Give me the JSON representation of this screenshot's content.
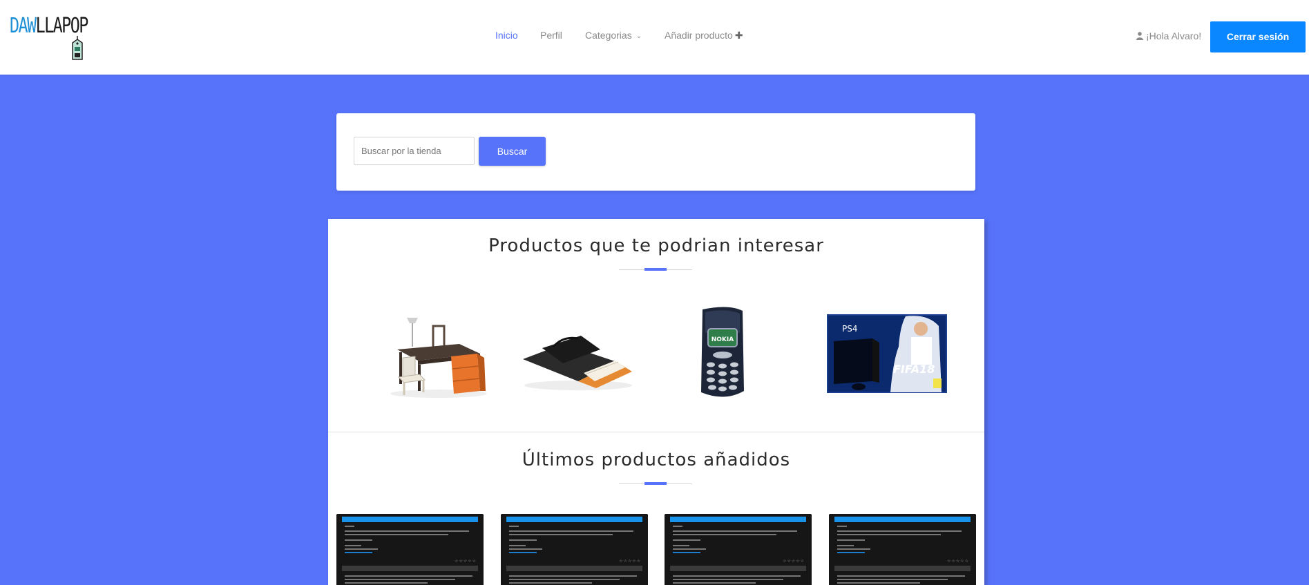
{
  "header": {
    "logo": {
      "part1": "DAW",
      "part2": "LLAPOP",
      "accent": "#1f8fd6"
    },
    "nav": {
      "inicio": "Inicio",
      "perfil": "Perfil",
      "categorias": "Categorias",
      "anadir": "Añadir producto"
    },
    "greeting": "¡Hola Alvaro!",
    "logout_label": "Cerrar sesión",
    "logout_color": "#0a86ff"
  },
  "search": {
    "placeholder": "Buscar por la tienda",
    "button_label": "Buscar"
  },
  "sections": {
    "recommended_title": "Productos que te podrian interesar",
    "latest_title": "Últimos productos añadidos"
  },
  "recommended_products": [
    {
      "icon": "desk-image"
    },
    {
      "icon": "bag-image"
    },
    {
      "icon": "nokia-phone-image",
      "brand_text": "NOKIA"
    },
    {
      "icon": "ps4-box-image",
      "brand_text": "PS4",
      "game_text": "FIFA18"
    }
  ],
  "latest_products": [
    {
      "icon": "screenshot-thumbnail"
    },
    {
      "icon": "screenshot-thumbnail"
    },
    {
      "icon": "screenshot-thumbnail"
    },
    {
      "icon": "screenshot-thumbnail"
    }
  ],
  "theme": {
    "accent": "#5773fa",
    "background": "#5773fa"
  }
}
